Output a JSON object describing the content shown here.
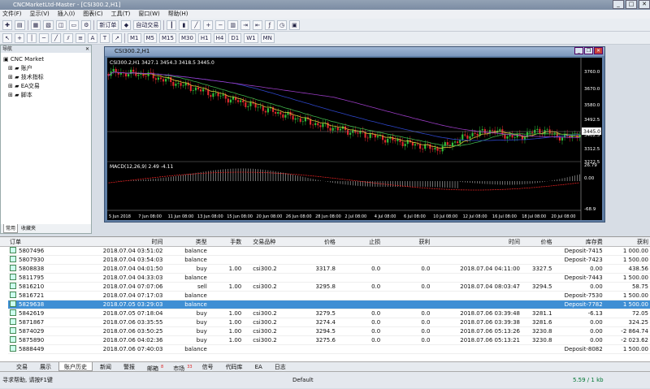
{
  "window": {
    "title": "CNCMarketLtd-Master - [CSI300.2,H1]"
  },
  "menu": [
    "文件(F)",
    "显示(V)",
    "插入(I)",
    "图表(C)",
    "工具(T)",
    "窗口(W)",
    "帮助(H)"
  ],
  "toolbar": {
    "new_order": "新订单",
    "auto_trade": "自动交易",
    "timeframes": [
      "M1",
      "M5",
      "M15",
      "M30",
      "H1",
      "H4",
      "D1",
      "W1",
      "MN"
    ]
  },
  "navigator": {
    "title": "导航",
    "items": [
      "CNC Market",
      "账户",
      "技术指标",
      "EA交易",
      "脚本"
    ],
    "tabs": [
      "常用",
      "收藏夹"
    ]
  },
  "chart": {
    "title": "CSI300.2,H1",
    "header": "CSI300.2,H1  3427.1 3454.3 3418.5 3445.0",
    "current_price": "3445.0",
    "price_ticks": [
      "3760.0",
      "3670.0",
      "3580.0",
      "3492.5",
      "3402.5",
      "3312.5",
      "3222.5"
    ],
    "macd_label": "MACD(12,26,9) 2.49 -4.11",
    "macd_ticks": [
      "26.79",
      "0.00",
      "-68.9"
    ],
    "time_ticks": [
      "5 Jun 2018",
      "7 Jun 08:00",
      "11 Jun 08:00",
      "13 Jun 08:00",
      "15 Jun 08:00",
      "20 Jun 08:00",
      "26 Jun 08:00",
      "28 Jun 08:00",
      "2 Jul 08:00",
      "4 Jul 08:00",
      "6 Jul 08:00",
      "10 Jul 08:00",
      "12 Jul 08:00",
      "16 Jul 08:00",
      "18 Jul 08:00",
      "20 Jul 08:00"
    ]
  },
  "terminal": {
    "side_label": "终端",
    "columns": [
      "订单",
      "时间",
      "类型",
      "手数",
      "交易品种",
      "价格",
      "止损",
      "获利",
      "时间",
      "价格",
      "库存费",
      "获利"
    ],
    "rows": [
      {
        "c": [
          "5807496",
          "2018.07.04 03:51:02",
          "balance",
          "",
          "",
          "",
          "",
          "",
          "",
          "",
          "Deposit-7415",
          "1 000.00"
        ]
      },
      {
        "c": [
          "5807930",
          "2018.07.04 03:54:03",
          "balance",
          "",
          "",
          "",
          "",
          "",
          "",
          "",
          "Deposit-7423",
          "1 500.00"
        ]
      },
      {
        "c": [
          "5808838",
          "2018.07.04 04:01:50",
          "buy",
          "1.00",
          "csi300.2",
          "3317.8",
          "0.0",
          "0.0",
          "2018.07.04 04:11:00",
          "3327.5",
          "0.00",
          "438.56"
        ]
      },
      {
        "c": [
          "5811795",
          "2018.07.04 04:33:03",
          "balance",
          "",
          "",
          "",
          "",
          "",
          "",
          "",
          "Deposit-7443",
          "1 500.00"
        ]
      },
      {
        "c": [
          "5816210",
          "2018.07.04 07:07:06",
          "sell",
          "1.00",
          "csi300.2",
          "3295.8",
          "0.0",
          "0.0",
          "2018.07.04 08:03:47",
          "3294.5",
          "0.00",
          "58.75"
        ]
      },
      {
        "c": [
          "5816721",
          "2018.07.04 07:17:03",
          "balance",
          "",
          "",
          "",
          "",
          "",
          "",
          "",
          "Deposit-7530",
          "1 500.00"
        ]
      },
      {
        "c": [
          "5829638",
          "2018.07.05 03:29:03",
          "balance",
          "",
          "",
          "",
          "",
          "",
          "",
          "",
          "Deposit-7782",
          "1 500.00"
        ],
        "selected": true
      },
      {
        "c": [
          "5842619",
          "2018.07.05 07:18:04",
          "buy",
          "1.00",
          "csi300.2",
          "3279.5",
          "0.0",
          "0.0",
          "2018.07.06 03:39:48",
          "3281.1",
          "-6.13",
          "72.05"
        ]
      },
      {
        "c": [
          "5871867",
          "2018.07.06 03:35:55",
          "buy",
          "1.00",
          "csi300.2",
          "3274.4",
          "0.0",
          "0.0",
          "2018.07.06 03:39:38",
          "3281.6",
          "0.00",
          "324.25"
        ]
      },
      {
        "c": [
          "5874029",
          "2018.07.06 03:50:25",
          "buy",
          "1.00",
          "csi300.2",
          "3294.5",
          "0.0",
          "0.0",
          "2018.07.06 05:13:26",
          "3230.8",
          "0.00",
          "-2 864.74"
        ]
      },
      {
        "c": [
          "5875890",
          "2018.07.06 04:02:36",
          "buy",
          "1.00",
          "csi300.2",
          "3275.6",
          "0.0",
          "0.0",
          "2018.07.06 05:13:21",
          "3230.8",
          "0.00",
          "-2 023.62"
        ]
      },
      {
        "c": [
          "5888449",
          "2018.07.06 07:40:03",
          "balance",
          "",
          "",
          "",
          "",
          "",
          "",
          "",
          "Deposit-8082",
          "1 500.00"
        ]
      }
    ],
    "tabs": [
      {
        "label": "交易"
      },
      {
        "label": "展示"
      },
      {
        "label": "账户历史",
        "active": true
      },
      {
        "label": "新闻"
      },
      {
        "label": "警报"
      },
      {
        "label": "邮箱",
        "badge": "8"
      },
      {
        "label": "市场",
        "badge": "33"
      },
      {
        "label": "信号"
      },
      {
        "label": "代码库"
      },
      {
        "label": "EA"
      },
      {
        "label": "日志"
      }
    ]
  },
  "status": {
    "help": "寻求帮助, 请按F1键",
    "profile": "Default",
    "connection": "5.59 / 1 kb"
  },
  "colors": {
    "bull": "#2fbf3a",
    "bear": "#e0282d",
    "ma_yellow": "#d8c83a",
    "ma_green": "#3fb34a",
    "ma_blue": "#2d45c8",
    "ma_purple": "#9a3cc4",
    "selected_row": "#3f8fd4"
  }
}
